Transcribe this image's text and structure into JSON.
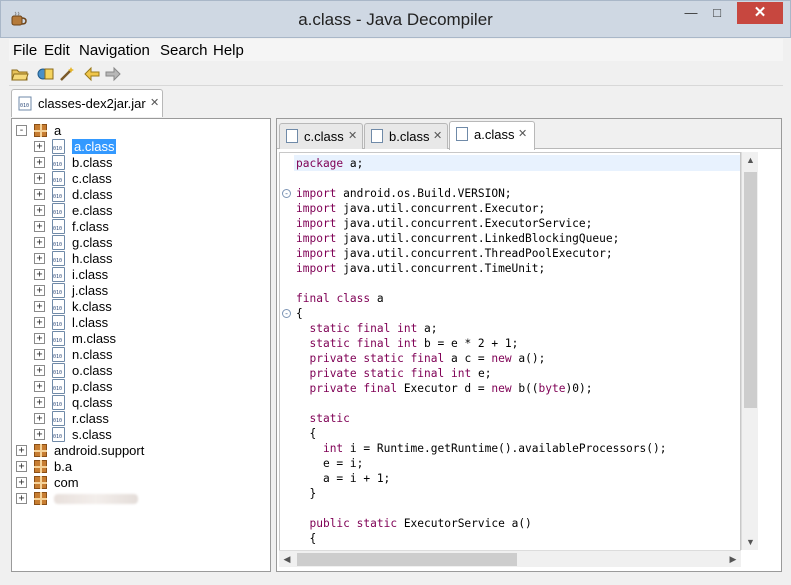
{
  "window": {
    "title": "a.class - Java Decompiler"
  },
  "menu": [
    "File",
    "Edit",
    "Navigation",
    "Search",
    "Help"
  ],
  "left_tab": {
    "label": "classes-dex2jar.jar"
  },
  "tree": {
    "root_a": "a",
    "a_children": [
      "a.class",
      "b.class",
      "c.class",
      "d.class",
      "e.class",
      "f.class",
      "g.class",
      "h.class",
      "i.class",
      "j.class",
      "k.class",
      "l.class",
      "m.class",
      "n.class",
      "o.class",
      "p.class",
      "q.class",
      "r.class",
      "s.class"
    ],
    "selected": "a.class",
    "other_packages": [
      "android.support",
      "b.a",
      "com"
    ]
  },
  "editor_tabs": [
    {
      "label": "c.class",
      "active": false
    },
    {
      "label": "b.class",
      "active": false
    },
    {
      "label": "a.class",
      "active": true
    }
  ],
  "code_lines": [
    "package a;",
    "",
    "import android.os.Build.VERSION;",
    "import java.util.concurrent.Executor;",
    "import java.util.concurrent.ExecutorService;",
    "import java.util.concurrent.LinkedBlockingQueue;",
    "import java.util.concurrent.ThreadPoolExecutor;",
    "import java.util.concurrent.TimeUnit;",
    "",
    "final class a",
    "{",
    "  static final int a;",
    "  static final int b = e * 2 + 1;",
    "  private static final a c = new a();",
    "  private static final int e;",
    "  private final Executor d = new b((byte)0);",
    "",
    "  static",
    "  {",
    "    int i = Runtime.getRuntime().availableProcessors();",
    "    e = i;",
    "    a = i + 1;",
    "  }",
    "",
    "  public static ExecutorService a()",
    "  {"
  ],
  "colors": {
    "keyword": "#7f0055",
    "selection": "#3399ff",
    "close_button": "#c7473f"
  }
}
